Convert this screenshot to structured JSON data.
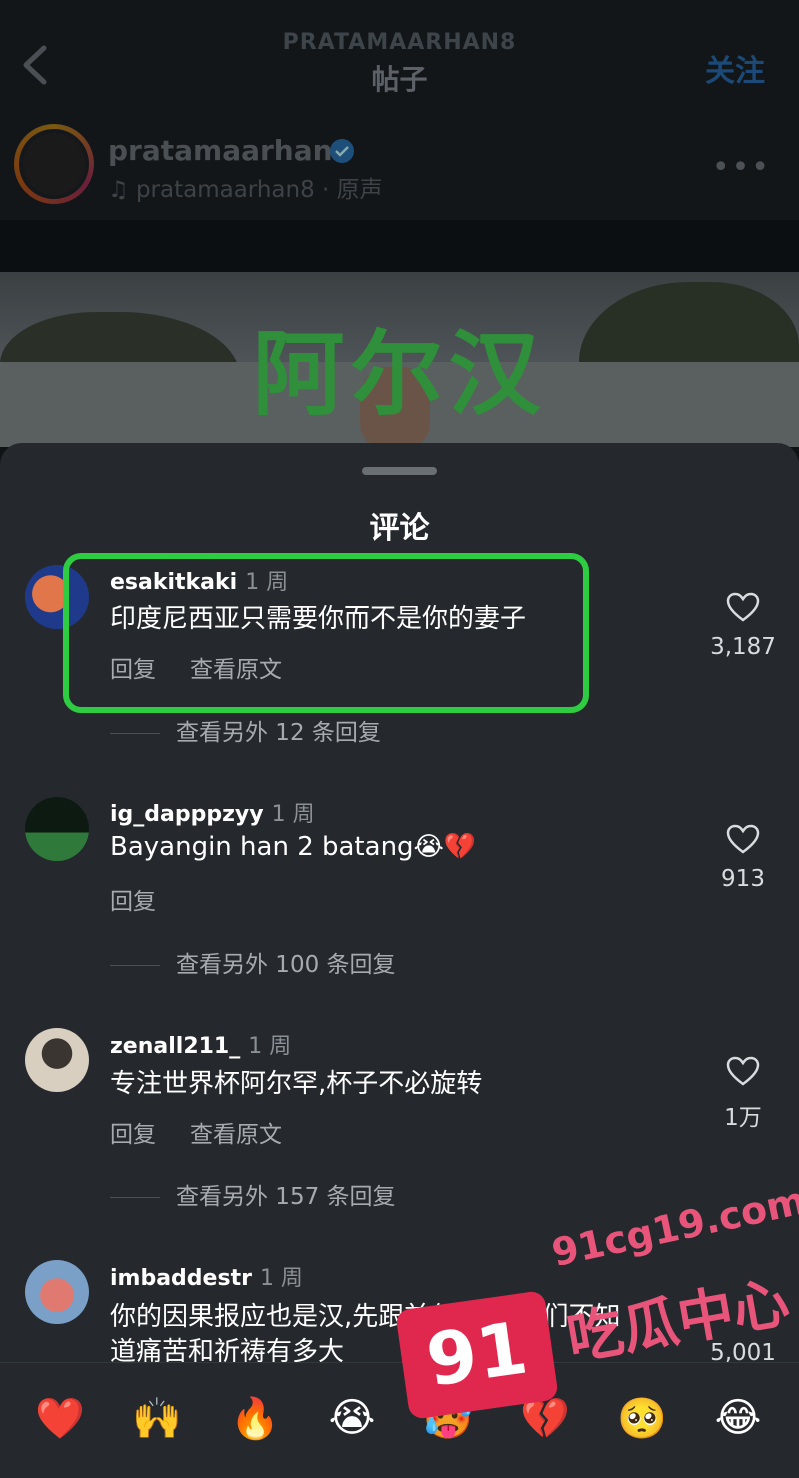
{
  "header": {
    "username": "PRATAMAARHAN8",
    "title": "帖子",
    "follow_label": "关注"
  },
  "author": {
    "name": "pratamaarhan8",
    "audio": "pratamaarhan8 · 原声"
  },
  "video": {
    "overlay_text": "阿尔汉"
  },
  "comments_sheet": {
    "title": "评论",
    "comments": [
      {
        "user": "esakitkaki",
        "time": "1 周",
        "text": "印度尼西亚只需要你而不是你的妻子",
        "reply_label": "回复",
        "translate_label": "查看原文",
        "likes": "3,187",
        "view_replies": "查看另外 12 条回复"
      },
      {
        "user": "ig_dapppzyy",
        "time": "1 周",
        "text": "Bayangin han 2 batang😭💔",
        "reply_label": "回复",
        "likes": "913",
        "view_replies": "查看另外 100 条回复"
      },
      {
        "user": "zenall211_",
        "time": "1 周",
        "text": "专注世界杯阿尔罕,杯子不必旋转",
        "reply_label": "回复",
        "translate_label": "查看原文",
        "likes": "1万",
        "view_replies": "查看另外 157 条回复"
      },
      {
        "user": "imbaddestr",
        "time": "1 周",
        "text_line1": "你的因果报应也是汉,先跟前任道歉,我们不知",
        "text_line2": "道痛苦和祈祷有多大",
        "likes": "5,001"
      }
    ]
  },
  "emoji_bar": [
    "❤️",
    "🙌",
    "🔥",
    "😭",
    "🥵",
    "💔",
    "🥺",
    "😂"
  ],
  "watermark": {
    "number": "91",
    "url": "91cg19.com",
    "text": "吃瓜中心"
  },
  "colors": {
    "highlight_box": "#2ecc40",
    "overlay_text": "#2f8f3b",
    "follow": "#1b4a78",
    "watermark": "#e0284f"
  }
}
